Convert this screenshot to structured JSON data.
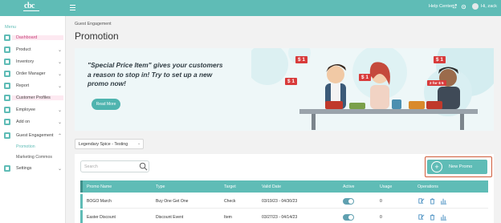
{
  "header": {
    "logo_text": "cbc",
    "help_label": "Help Center",
    "user_greeting": "Hi, zack"
  },
  "sidebar": {
    "menu_label": "Menu",
    "items": [
      {
        "label": "Dashboard",
        "has_chevron": false
      },
      {
        "label": "Product",
        "has_chevron": true
      },
      {
        "label": "Inventory",
        "has_chevron": true
      },
      {
        "label": "Order Manager",
        "has_chevron": true
      },
      {
        "label": "Report",
        "has_chevron": true
      },
      {
        "label": "Customer Profiles",
        "has_chevron": false
      },
      {
        "label": "Employee",
        "has_chevron": true
      },
      {
        "label": "Add on",
        "has_chevron": true
      },
      {
        "label": "Guest Engagement",
        "has_chevron": true
      },
      {
        "label": "Settings",
        "has_chevron": true
      }
    ],
    "sub_items": [
      "Promotion",
      "Marketing Commos"
    ],
    "chevron_glyph": "⌄",
    "chevron_up_glyph": "⌃"
  },
  "page": {
    "breadcrumb": "Guest Engagement",
    "title": "Promotion"
  },
  "banner": {
    "text": "\"Special Price Item\" gives your customers a reason to stop in! Try to set up a new promo now!",
    "button_label": "Read More",
    "tags": [
      "$ 1",
      "$ 1",
      "$ 1",
      "$ 1",
      "2 for $ 5"
    ]
  },
  "location_select": {
    "value": "Legendary Spice - Testing",
    "caret": "⌄"
  },
  "search": {
    "placeholder": "Search"
  },
  "new_promo_button": {
    "label": "New Promo",
    "plus": "+"
  },
  "table": {
    "columns": [
      "Promo Name",
      "Type",
      "Target",
      "Valid Date",
      "Active",
      "Usage",
      "Operations"
    ],
    "rows": [
      {
        "name": "BOGO March",
        "type": "Buy One Get One",
        "target": "Check",
        "valid": "03/19/23 - 04/30/23",
        "active": true,
        "usage": "0"
      },
      {
        "name": "Easter Discount",
        "type": "Discount Event",
        "target": "Item",
        "valid": "03/27/23 - 04/14/23",
        "active": true,
        "usage": "0"
      }
    ]
  },
  "colors": {
    "accent": "#5fbcb6",
    "highlight_border": "#d05c3b",
    "active_nav": "#c9417a"
  }
}
